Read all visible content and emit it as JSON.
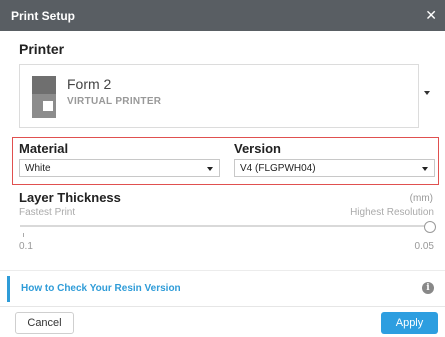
{
  "window": {
    "title": "Print Setup",
    "close_glyph": "✕"
  },
  "printer": {
    "heading": "Printer",
    "name": "Form 2",
    "subtitle": "VIRTUAL PRINTER",
    "icon": "printer-icon"
  },
  "material": {
    "label": "Material",
    "value": "White"
  },
  "version": {
    "label": "Version",
    "value": "V4 (FLGPWH04)"
  },
  "layer_thickness": {
    "heading": "Layer Thickness",
    "unit": "(mm)",
    "left_caption": "Fastest Print",
    "right_caption": "Highest Resolution",
    "min_label": "0.1",
    "max_label": "0.05",
    "selected_fraction": 1.0
  },
  "help": {
    "link_text": "How to Check Your Resin Version",
    "info_glyph": "i"
  },
  "footer": {
    "cancel_label": "Cancel",
    "apply_label": "Apply"
  },
  "colors": {
    "titlebar": "#595e63",
    "accent": "#2d9ee0",
    "highlight_border": "#e0504f"
  }
}
